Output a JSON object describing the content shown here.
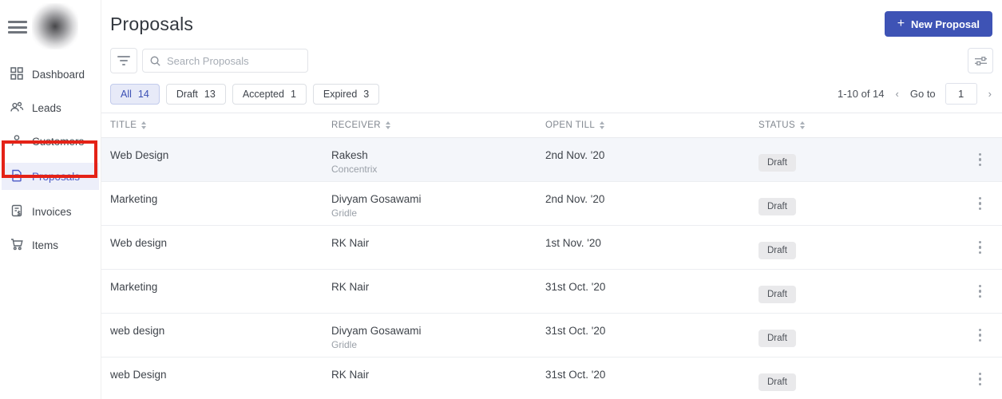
{
  "sidebar": {
    "items": [
      {
        "label": "Dashboard",
        "icon": "grid-icon",
        "active": false
      },
      {
        "label": "Leads",
        "icon": "people-icon",
        "active": false
      },
      {
        "label": "Customers",
        "icon": "person-icon",
        "active": false
      },
      {
        "label": "Proposals",
        "icon": "document-icon",
        "active": true
      },
      {
        "label": "Invoices",
        "icon": "invoice-icon",
        "active": false
      },
      {
        "label": "Items",
        "icon": "cart-icon",
        "active": false
      }
    ]
  },
  "header": {
    "title": "Proposals",
    "new_button_label": "New Proposal",
    "new_button_plus": "+"
  },
  "toolbar": {
    "search_placeholder": "Search Proposals"
  },
  "tabs": [
    {
      "label": "All",
      "count": "14",
      "active": true
    },
    {
      "label": "Draft",
      "count": "13",
      "active": false
    },
    {
      "label": "Accepted",
      "count": "1",
      "active": false
    },
    {
      "label": "Expired",
      "count": "3",
      "active": false
    }
  ],
  "pagination": {
    "range": "1-10 of 14",
    "prev": "‹",
    "goto_label": "Go to",
    "page_value": "1",
    "next": "›"
  },
  "table": {
    "columns": [
      "TITLE",
      "RECEIVER",
      "OPEN TILL",
      "STATUS"
    ],
    "rows": [
      {
        "title": "Web Design",
        "receiver": "Rakesh",
        "company": "Concentrix",
        "open_till": "2nd Nov. '20",
        "status": "Draft",
        "highlighted": true
      },
      {
        "title": "Marketing",
        "receiver": "Divyam Gosawami",
        "company": "Gridle",
        "open_till": "2nd Nov. '20",
        "status": "Draft",
        "highlighted": false
      },
      {
        "title": "Web design",
        "receiver": "RK Nair",
        "company": "",
        "open_till": "1st Nov. '20",
        "status": "Draft",
        "highlighted": false
      },
      {
        "title": "Marketing",
        "receiver": "RK Nair",
        "company": "",
        "open_till": "31st Oct. '20",
        "status": "Draft",
        "highlighted": false
      },
      {
        "title": "web design",
        "receiver": "Divyam Gosawami",
        "company": "Gridle",
        "open_till": "31st Oct. '20",
        "status": "Draft",
        "highlighted": false
      },
      {
        "title": "web Design",
        "receiver": "RK Nair",
        "company": "",
        "open_till": "31st Oct. '20",
        "status": "Draft",
        "highlighted": false
      }
    ]
  },
  "colors": {
    "accent": "#3e53b5",
    "active_tab_bg": "#e7eaf8",
    "sidebar_active_bg": "#edeffa",
    "annotation_red": "#e42217",
    "badge_bg": "#e9e9eb",
    "row_highlight": "#f4f6fa"
  }
}
